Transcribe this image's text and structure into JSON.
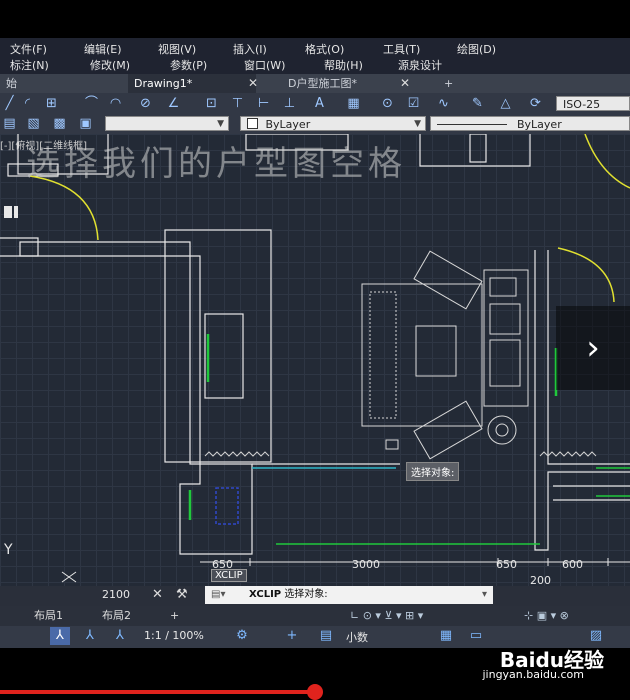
{
  "menu": {
    "row1": [
      "文件(F)",
      "编辑(E)",
      "视图(V)",
      "插入(I)",
      "格式(O)",
      "工具(T)",
      "绘图(D)"
    ],
    "row2": [
      "标注(N)",
      "修改(M)",
      "参数(P)",
      "窗口(W)",
      "帮助(H)",
      "源泉设计"
    ]
  },
  "tabs": {
    "start": "始",
    "drawing1": "Drawing1*",
    "second": "D户型施工图*",
    "add": "+"
  },
  "toolbar": {
    "annotation_scale": "ISO-25",
    "color_dropdown": "ByLayer",
    "linetype_dropdown": "ByLayer"
  },
  "canvas": {
    "overlay_title": "选择我们的户型图空格",
    "view_label": "[-][俯视][二维线框]",
    "tooltip": "选择对象:",
    "dimensions": {
      "d650_left": "650",
      "d3000": "3000",
      "d650_right": "650",
      "d600": "600",
      "d200": "200",
      "d2100": "2100"
    }
  },
  "command": {
    "tip": "XCLIP",
    "name": "XCLIP",
    "prompt": "选择对象:"
  },
  "layouts": {
    "layout1": "布局1",
    "layout2": "布局2",
    "add": "+"
  },
  "status": {
    "scale": "1:1 / 100%",
    "units": "小数"
  },
  "watermark": {
    "brand": "Baidu经验",
    "url": "jingyan.baidu.com"
  },
  "video": {
    "progress": 0.5
  }
}
